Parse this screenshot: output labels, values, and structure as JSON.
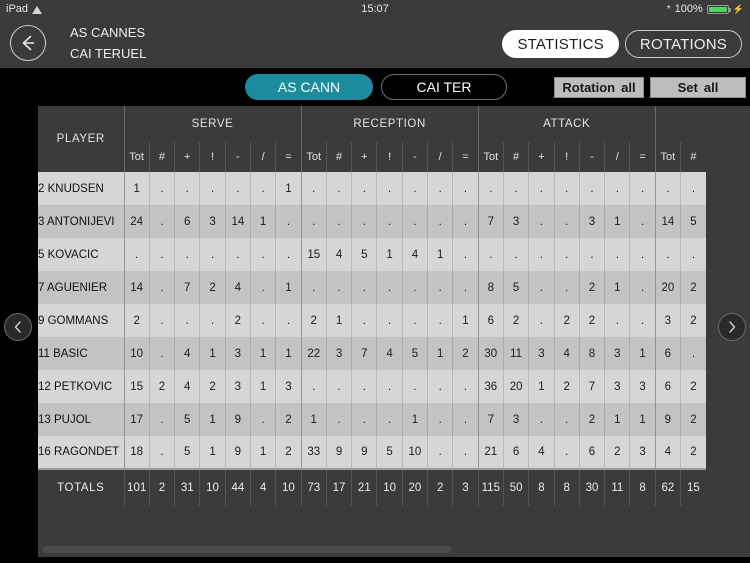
{
  "status_bar": {
    "device": "iPad",
    "wifi_icon": "wifi-icon",
    "time": "15:07",
    "bluetooth_icon": "bluetooth-icon",
    "battery_percent": "100%",
    "battery_icon": "battery-full-icon",
    "charging_icon": "charging-plug-icon"
  },
  "nav": {
    "back_icon": "back-arrow-icon",
    "team_home": "AS CANNES",
    "team_away": "CAI TERUEL",
    "segments": [
      {
        "label": "STATISTICS",
        "active": true
      },
      {
        "label": "ROTATIONS",
        "active": false
      }
    ]
  },
  "toolbar": {
    "team_tabs": [
      {
        "label": "AS CANN",
        "active": true
      },
      {
        "label": "CAI TER",
        "active": false
      }
    ],
    "rotation_filter": {
      "label": "Rotation",
      "value": "all"
    },
    "set_filter": {
      "label": "Set",
      "value": "all"
    },
    "accent_color": "#1b8b9d"
  },
  "table": {
    "player_header": "PLAYER",
    "groups": [
      {
        "name": "SERVE",
        "span": 7
      },
      {
        "name": "RECEPTION",
        "span": 7
      },
      {
        "name": "ATTACK",
        "span": 7
      },
      {
        "name": "",
        "span": 2
      }
    ],
    "sub_headers": [
      "Tot",
      "#",
      "+",
      "!",
      "-",
      "/",
      "="
    ],
    "tail_headers": [
      "Tot",
      "#"
    ],
    "rows": [
      {
        "player": "2 KNUDSEN",
        "serve": [
          "1",
          ".",
          ".",
          ".",
          ".",
          ".",
          "1"
        ],
        "reception": [
          ".",
          ".",
          ".",
          ".",
          ".",
          ".",
          "."
        ],
        "attack": [
          ".",
          ".",
          ".",
          ".",
          ".",
          ".",
          "."
        ],
        "tail": [
          ".",
          "."
        ]
      },
      {
        "player": "3 ANTONIJEVI",
        "serve": [
          "24",
          ".",
          "6",
          "3",
          "14",
          "1",
          "."
        ],
        "reception": [
          ".",
          ".",
          ".",
          ".",
          ".",
          ".",
          "."
        ],
        "attack": [
          "7",
          "3",
          ".",
          ".",
          "3",
          "1",
          "."
        ],
        "tail": [
          "14",
          "5"
        ]
      },
      {
        "player": "5 KOVACIC",
        "serve": [
          ".",
          ".",
          ".",
          ".",
          ".",
          ".",
          "."
        ],
        "reception": [
          "15",
          "4",
          "5",
          "1",
          "4",
          "1",
          "."
        ],
        "attack": [
          ".",
          ".",
          ".",
          ".",
          ".",
          ".",
          "."
        ],
        "tail": [
          ".",
          "."
        ]
      },
      {
        "player": "7 AGUENIER",
        "serve": [
          "14",
          ".",
          "7",
          "2",
          "4",
          ".",
          "1"
        ],
        "reception": [
          ".",
          ".",
          ".",
          ".",
          ".",
          ".",
          "."
        ],
        "attack": [
          "8",
          "5",
          ".",
          ".",
          "2",
          "1",
          "."
        ],
        "tail": [
          "20",
          "2"
        ]
      },
      {
        "player": "9 GOMMANS",
        "serve": [
          "2",
          ".",
          ".",
          ".",
          "2",
          ".",
          "."
        ],
        "reception": [
          "2",
          "1",
          ".",
          ".",
          ".",
          ".",
          "1"
        ],
        "attack": [
          "6",
          "2",
          ".",
          "2",
          "2",
          ".",
          "."
        ],
        "tail": [
          "3",
          "2"
        ]
      },
      {
        "player": "11 BASIC",
        "serve": [
          "10",
          ".",
          "4",
          "1",
          "3",
          "1",
          "1"
        ],
        "reception": [
          "22",
          "3",
          "7",
          "4",
          "5",
          "1",
          "2"
        ],
        "attack": [
          "30",
          "11",
          "3",
          "4",
          "8",
          "3",
          "1"
        ],
        "tail": [
          "6",
          "."
        ]
      },
      {
        "player": "12 PETKOVIC",
        "serve": [
          "15",
          "2",
          "4",
          "2",
          "3",
          "1",
          "3"
        ],
        "reception": [
          ".",
          ".",
          ".",
          ".",
          ".",
          ".",
          "."
        ],
        "attack": [
          "36",
          "20",
          "1",
          "2",
          "7",
          "3",
          "3"
        ],
        "tail": [
          "6",
          "2"
        ]
      },
      {
        "player": "13 PUJOL",
        "serve": [
          "17",
          ".",
          "5",
          "1",
          "9",
          ".",
          "2"
        ],
        "reception": [
          "1",
          ".",
          ".",
          ".",
          "1",
          ".",
          "."
        ],
        "attack": [
          "7",
          "3",
          ".",
          ".",
          "2",
          "1",
          "1"
        ],
        "tail": [
          "9",
          "2"
        ]
      },
      {
        "player": "16 RAGONDET",
        "serve": [
          "18",
          ".",
          "5",
          "1",
          "9",
          "1",
          "2"
        ],
        "reception": [
          "33",
          "9",
          "9",
          "5",
          "10",
          ".",
          "."
        ],
        "attack": [
          "21",
          "6",
          "4",
          ".",
          "6",
          "2",
          "3"
        ],
        "tail": [
          "4",
          "2"
        ]
      }
    ],
    "totals": {
      "label": "TOTALS",
      "serve": [
        "101",
        "2",
        "31",
        "10",
        "44",
        "4",
        "10"
      ],
      "reception": [
        "73",
        "17",
        "21",
        "10",
        "20",
        "2",
        "3"
      ],
      "attack": [
        "115",
        "50",
        "8",
        "8",
        "30",
        "11",
        "8"
      ],
      "tail": [
        "62",
        "15"
      ]
    }
  },
  "pagination": {
    "prev_icon": "chevron-left-icon",
    "next_icon": "chevron-right-icon"
  },
  "scrollbar": {
    "orientation": "horizontal"
  }
}
